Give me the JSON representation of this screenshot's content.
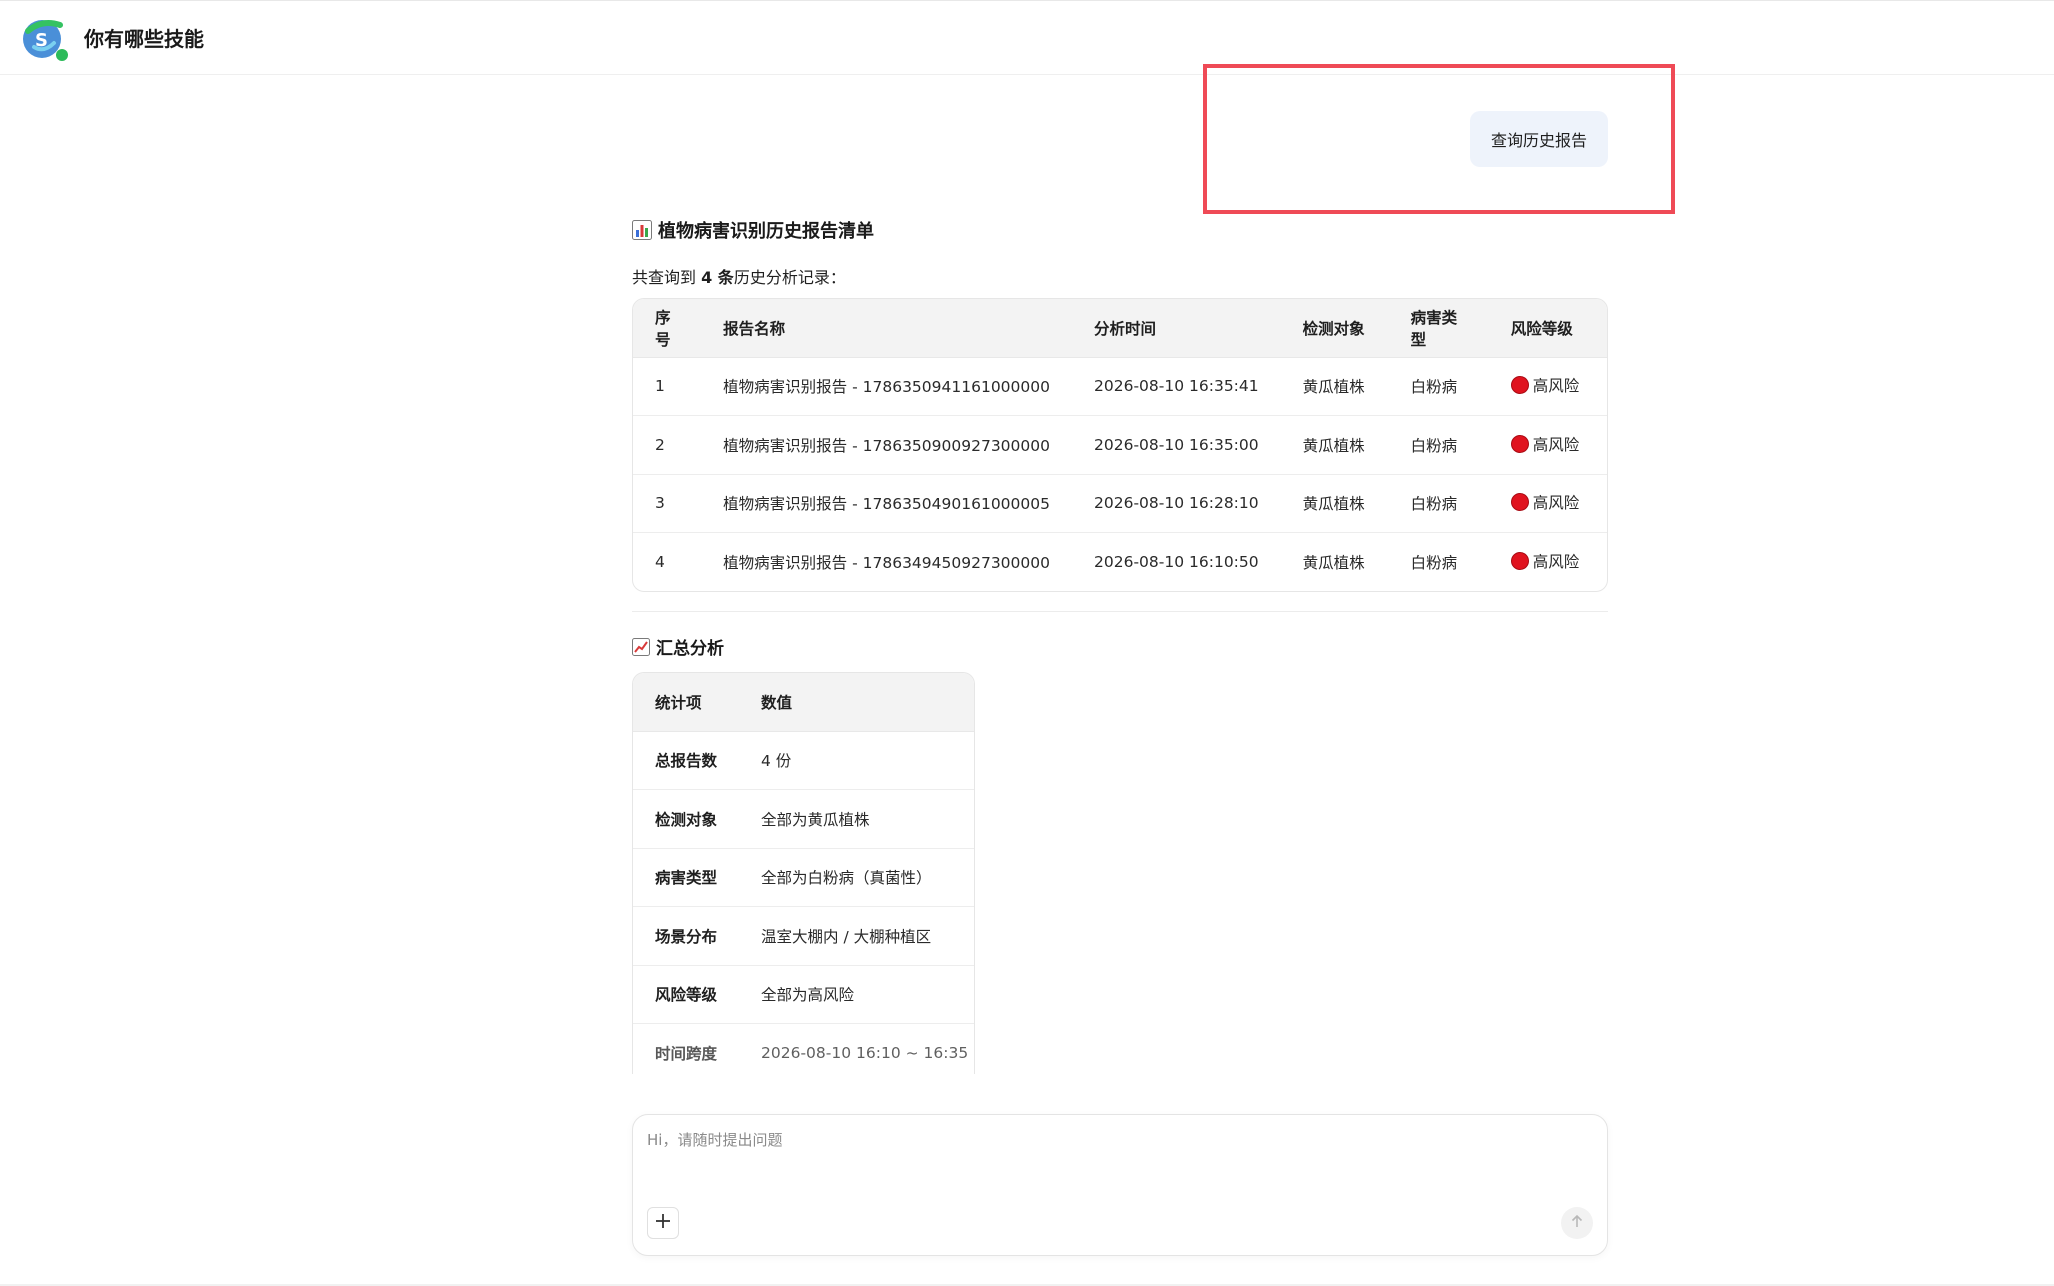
{
  "header": {
    "title": "你有哪些技能"
  },
  "user_message": "查询历史报告",
  "report_list": {
    "title": "植物病害识别历史报告清单",
    "summary_prefix": "共查询到 ",
    "summary_count": "4 条",
    "summary_suffix": "历史分析记录：",
    "columns": [
      "序号",
      "报告名称",
      "分析时间",
      "检测对象",
      "病害类型",
      "风险等级"
    ],
    "rows": [
      {
        "index": "1",
        "name": "植物病害识别报告 - 1786350941161000000",
        "time": "2026-08-10 16:35:41",
        "object": "黄瓜植株",
        "disease": "白粉病",
        "risk": "高风险"
      },
      {
        "index": "2",
        "name": "植物病害识别报告 - 1786350900927300000",
        "time": "2026-08-10 16:35:00",
        "object": "黄瓜植株",
        "disease": "白粉病",
        "risk": "高风险"
      },
      {
        "index": "3",
        "name": "植物病害识别报告 - 1786350490161000005",
        "time": "2026-08-10 16:28:10",
        "object": "黄瓜植株",
        "disease": "白粉病",
        "risk": "高风险"
      },
      {
        "index": "4",
        "name": "植物病害识别报告 - 1786349450927300000",
        "time": "2026-08-10 16:10:50",
        "object": "黄瓜植株",
        "disease": "白粉病",
        "risk": "高风险"
      }
    ]
  },
  "summary_analysis": {
    "title": "汇总分析",
    "columns": [
      "统计项",
      "数值"
    ],
    "rows": [
      {
        "key": "总报告数",
        "value": "4 份"
      },
      {
        "key": "检测对象",
        "value": "全部为黄瓜植株"
      },
      {
        "key": "病害类型",
        "value": "全部为白粉病（真菌性）"
      },
      {
        "key": "场景分布",
        "value": "温室大棚内 / 大棚种植区"
      },
      {
        "key": "风险等级",
        "value": "全部为高风险"
      },
      {
        "key": "时间跨度",
        "value": "2026-08-10 16:10 ~ 16:35"
      }
    ]
  },
  "composer": {
    "placeholder": "Hi，请随时提出问题",
    "value": ""
  },
  "colors": {
    "accent_box": "#ef4a56",
    "risk_dot": "#e0131f",
    "user_bubble": "#eef3fb"
  },
  "icons": {
    "chart": "bar-chart-icon",
    "trend": "trend-chart-icon",
    "plus": "plus-icon",
    "send": "arrow-up-icon"
  }
}
